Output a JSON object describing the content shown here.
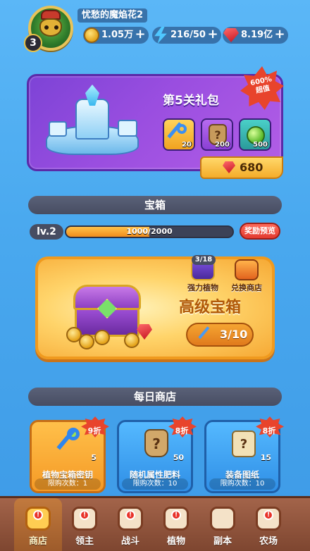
{
  "player": {
    "name": "忧愁的魔焰花2",
    "level": "3"
  },
  "resources": {
    "coins": "1.05万",
    "energy": "216/50",
    "gems": "8.19亿",
    "plus": "+"
  },
  "gift_pack": {
    "title": "第5关礼包",
    "discount": "600%\n超值",
    "items": [
      {
        "icon": "key-icon",
        "qty": "20"
      },
      {
        "icon": "mystery-bag-icon",
        "qty": "200"
      },
      {
        "icon": "green-orb-icon",
        "qty": "500"
      }
    ],
    "price": "680"
  },
  "chest_section": {
    "header": "宝箱",
    "level_label": "lv.2",
    "progress_text": "1000/2000",
    "progress_fraction": 0.5,
    "reward_preview": "奖励预览",
    "plant_count": "3/18",
    "strong_plants": "强力植物",
    "exchange_shop": "兑换商店",
    "chest_title": "高级宝箱",
    "key_count": "3/10"
  },
  "daily_shop": {
    "header": "每日商店",
    "items": [
      {
        "discount": "9折",
        "qty": "5",
        "name": "植物宝箱密钥",
        "limit": "限购次数：1"
      },
      {
        "discount": "8折",
        "qty": "50",
        "name": "随机属性肥料",
        "limit": "限购次数：10"
      },
      {
        "discount": "8折",
        "qty": "15",
        "name": "装备图纸",
        "limit": "限购次数：10"
      }
    ]
  },
  "nav": {
    "items": [
      {
        "label": "商店",
        "badge": "!"
      },
      {
        "label": "领主",
        "badge": "!"
      },
      {
        "label": "战斗",
        "badge": "!"
      },
      {
        "label": "植物",
        "badge": "!"
      },
      {
        "label": "副本",
        "badge": "!"
      },
      {
        "label": "农场",
        "badge": "!"
      }
    ]
  }
}
